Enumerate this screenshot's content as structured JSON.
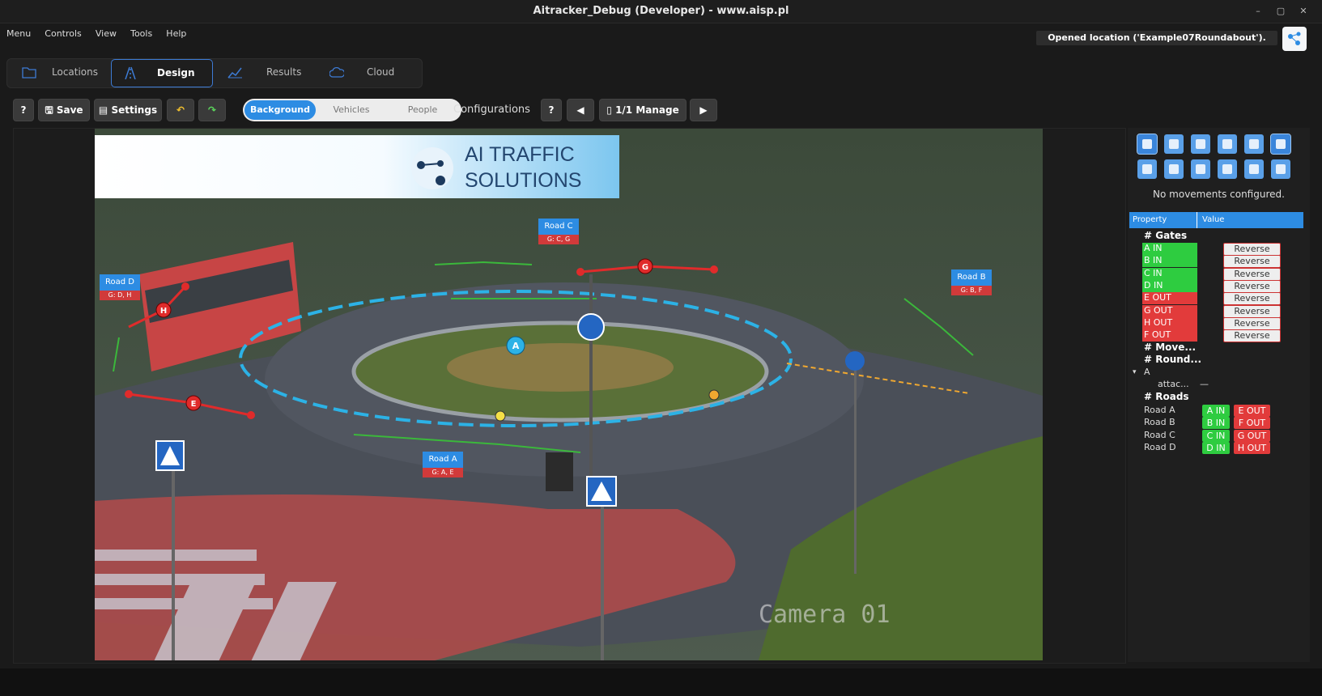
{
  "window": {
    "title": "Aitracker_Debug (Developer) - www.aisp.pl"
  },
  "menu": [
    "Menu",
    "Controls",
    "View",
    "Tools",
    "Help"
  ],
  "status_message": "Opened location ('Example07Roundabout').",
  "tabs": [
    {
      "label": "Locations",
      "icon": "folder-icon"
    },
    {
      "label": "Design",
      "icon": "road-icon",
      "active": true
    },
    {
      "label": "Results",
      "icon": "chart-icon"
    },
    {
      "label": "Cloud",
      "icon": "cloud-icon"
    }
  ],
  "toolbar": {
    "help": "?",
    "save": "Save",
    "settings": "Settings",
    "segments": [
      "Background",
      "Vehicles",
      "People"
    ],
    "configurations_label": "Configurations :",
    "conf_help": "?",
    "manage": "1/1 Manage"
  },
  "banner": {
    "line1": "AI TRAFFIC",
    "line2": "SOLUTIONS"
  },
  "camera_label": "Camera 01",
  "road_labels": [
    {
      "name": "Road C",
      "gates": "G: C, G"
    },
    {
      "name": "Road B",
      "gates": "G: B, F"
    },
    {
      "name": "Road D",
      "gates": "G: D, H"
    },
    {
      "name": "Road A",
      "gates": "G: A, E"
    }
  ],
  "roundabout_marker": "A",
  "gate_markers": [
    "G",
    "H",
    "E"
  ],
  "right_panel": {
    "no_movements": "No movements configured.",
    "header": {
      "property": "Property",
      "value": "Value"
    },
    "gates_title": "# Gates",
    "gates": [
      {
        "name": "A IN",
        "color": "#2ecc40",
        "action": "Reverse"
      },
      {
        "name": "B IN",
        "color": "#2ecc40",
        "action": "Reverse"
      },
      {
        "name": "C IN",
        "color": "#2ecc40",
        "action": "Reverse"
      },
      {
        "name": "D IN",
        "color": "#2ecc40",
        "action": "Reverse"
      },
      {
        "name": "E OUT",
        "color": "#e23b3b",
        "action": "Reverse"
      },
      {
        "name": "G OUT",
        "color": "#e23b3b",
        "action": "Reverse"
      },
      {
        "name": "H OUT",
        "color": "#e23b3b",
        "action": "Reverse"
      },
      {
        "name": "F OUT",
        "color": "#e23b3b",
        "action": "Reverse"
      }
    ],
    "movements_title": "# Move...",
    "roundabouts_title": "# Round...",
    "roundabout_item": "A",
    "attach_label": "attac...",
    "attach_value": "—",
    "roads_title": "# Roads",
    "roads": [
      {
        "name": "Road A",
        "in": "A IN",
        "out": "E OUT"
      },
      {
        "name": "Road B",
        "in": "B IN",
        "out": "F OUT"
      },
      {
        "name": "Road C",
        "in": "C IN",
        "out": "G OUT"
      },
      {
        "name": "Road D",
        "in": "D IN",
        "out": "H OUT"
      }
    ]
  },
  "colors": {
    "accent": "#2d8ce3",
    "in": "#2ecc40",
    "out": "#e23b3b"
  }
}
